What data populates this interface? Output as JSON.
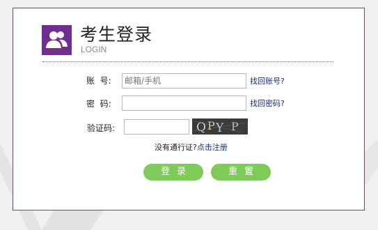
{
  "header": {
    "title": "考生登录",
    "subtitle": "LOGIN",
    "logo_icon": "users-icon"
  },
  "form": {
    "account_label": "账  号:",
    "account_placeholder": "邮箱/手机",
    "password_label": "密  码:",
    "password_value": "",
    "captcha_label": "验证码:",
    "captcha_value": "",
    "captcha_image_text": "QPYP"
  },
  "links": {
    "forgot_account": "找回账号?",
    "forgot_password": "找回密码?",
    "no_pass_prefix": "没有通行证?",
    "register": "点击注册"
  },
  "buttons": {
    "login": "登录",
    "reset": "重置"
  },
  "colors": {
    "brand_purple": "#6f2f8e",
    "button_green": "#7ecb5a",
    "link_blue": "#1a2a8c"
  }
}
